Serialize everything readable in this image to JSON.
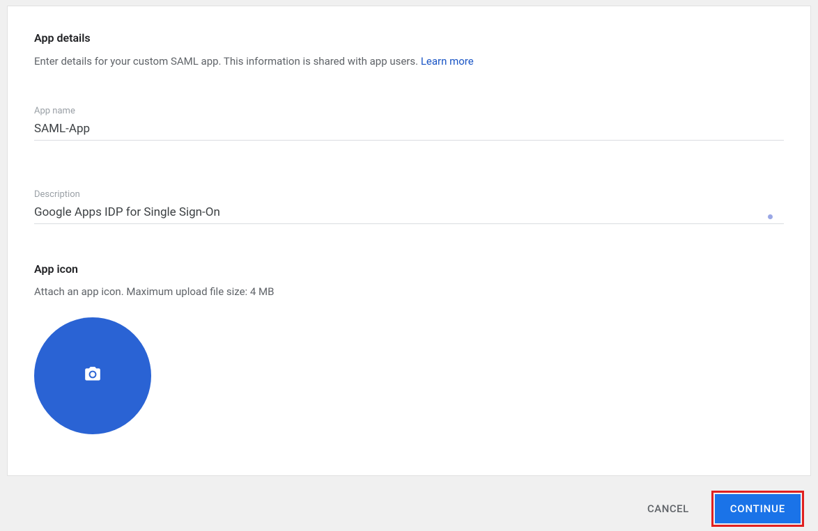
{
  "details": {
    "heading": "App details",
    "subtext": "Enter details for your custom SAML app. This information is shared with app users. ",
    "learn_more": "Learn more"
  },
  "fields": {
    "app_name_label": "App name",
    "app_name_value": "SAML-App",
    "description_label": "Description",
    "description_value": "Google Apps IDP for Single Sign-On"
  },
  "icon": {
    "heading": "App icon",
    "subtext": "Attach an app icon. Maximum upload file size: 4 MB"
  },
  "footer": {
    "cancel": "CANCEL",
    "continue": "CONTINUE"
  }
}
